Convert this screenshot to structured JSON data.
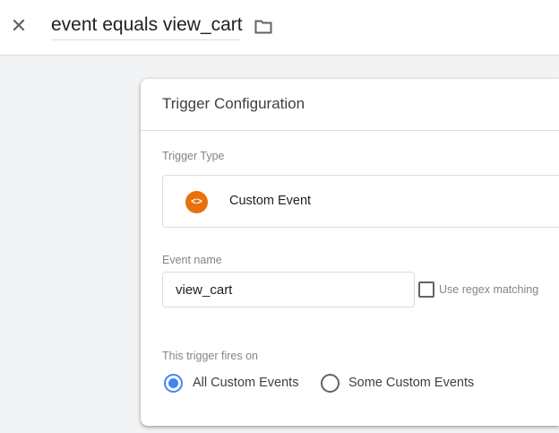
{
  "header": {
    "title": "event equals view_cart",
    "close_icon": "close-icon",
    "folder_icon": "folder-icon"
  },
  "card": {
    "title": "Trigger Configuration",
    "trigger_type_label": "Trigger Type",
    "trigger_type": {
      "name": "Custom Event",
      "icon": "code-icon",
      "icon_glyph": "<>",
      "icon_color": "#e8710a"
    },
    "event_name_label": "Event name",
    "event_name_value": "view_cart",
    "regex_label": "Use regex matching",
    "regex_checked": false,
    "fires_on_label": "This trigger fires on",
    "fires_on_options": [
      {
        "label": "All Custom Events",
        "selected": true
      },
      {
        "label": "Some Custom Events",
        "selected": false
      }
    ],
    "accent_color": "#4285f4"
  }
}
